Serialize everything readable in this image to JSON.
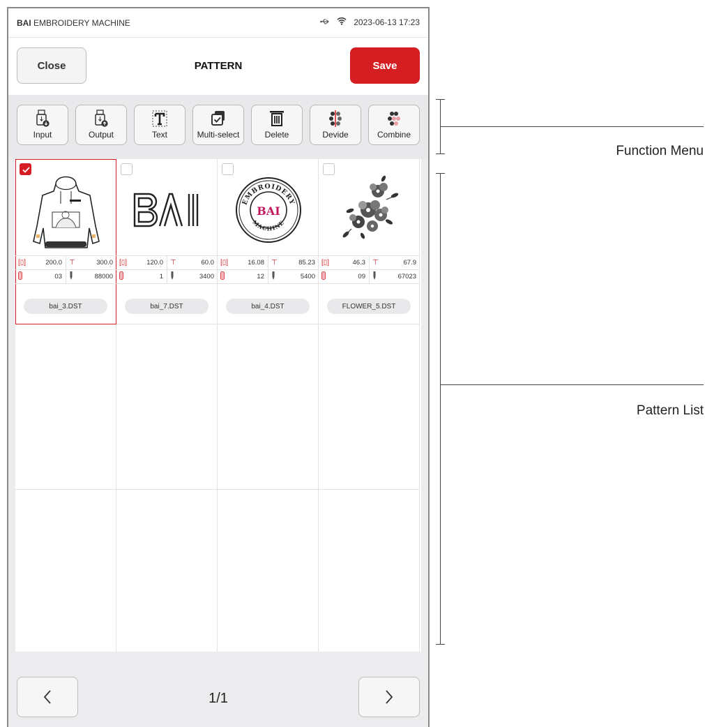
{
  "statusbar": {
    "brand_bold": "BAI",
    "brand_rest": "EMBROIDERY MACHINE",
    "datetime": "2023-06-13 17:23",
    "icons": [
      "usb-icon",
      "wifi-icon"
    ]
  },
  "header": {
    "close_label": "Close",
    "title": "PATTERN",
    "save_label": "Save"
  },
  "toolbar": {
    "items": [
      {
        "label": "Input",
        "icon": "usb-input-icon"
      },
      {
        "label": "Output",
        "icon": "usb-output-icon"
      },
      {
        "label": "Text",
        "icon": "text-icon"
      },
      {
        "label": "Multi-select",
        "icon": "multi-select-icon"
      },
      {
        "label": "Delete",
        "icon": "trash-icon"
      },
      {
        "label": "Devide",
        "icon": "divide-icon"
      },
      {
        "label": "Combine",
        "icon": "combine-icon"
      }
    ]
  },
  "patterns": [
    {
      "name": "bai_3.DST",
      "width": "200.0",
      "height": "300.0",
      "colors": "03",
      "stitches": "88000",
      "checked": true,
      "thumb": "hoodie"
    },
    {
      "name": "bai_7.DST",
      "width": "120.0",
      "height": "60.0",
      "colors": "1",
      "stitches": "3400",
      "checked": false,
      "thumb": "bai-logo"
    },
    {
      "name": "bai_4.DST",
      "width": "16.08",
      "height": "85.23",
      "colors": "12",
      "stitches": "5400",
      "checked": false,
      "thumb": "badge",
      "badge_top": "EMBROIDERY",
      "badge_center": "BAI",
      "badge_bottom": "MACHINE",
      "logo_text": "BAI"
    },
    {
      "name": "FLOWER_5.DST",
      "width": "46.3",
      "height": "67.9",
      "colors": "09",
      "stitches": "67023",
      "checked": false,
      "thumb": "flower"
    }
  ],
  "pagination": {
    "page": "1/1"
  },
  "annotations": {
    "function_menu": "Function Menu",
    "pattern_list": "Pattern List"
  },
  "colors": {
    "accent": "#d51e22",
    "toolbar_bg": "#e9e9eb"
  }
}
